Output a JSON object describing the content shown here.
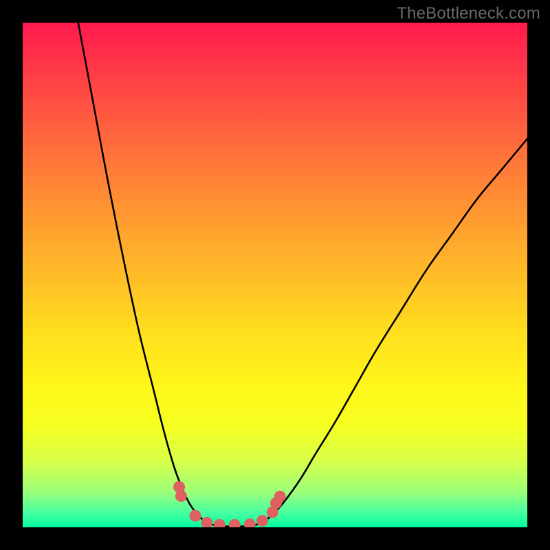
{
  "watermark": "TheBottleneck.com",
  "chart_data": {
    "type": "line",
    "title": "",
    "xlabel": "",
    "ylabel": "",
    "xlim": [
      0,
      100
    ],
    "ylim": [
      0,
      100
    ],
    "series": [
      {
        "name": "left-branch",
        "x": [
          11,
          14,
          17,
          20,
          23,
          26,
          28,
          30,
          31.5,
          33,
          34.5,
          36,
          38
        ],
        "y": [
          100,
          84,
          68,
          53,
          39,
          27,
          19,
          12,
          8,
          4.8,
          2.7,
          1.3,
          0.4
        ]
      },
      {
        "name": "valley-floor",
        "x": [
          38,
          40,
          42,
          44,
          46
        ],
        "y": [
          0.4,
          0.2,
          0.2,
          0.2,
          0.4
        ]
      },
      {
        "name": "right-branch",
        "x": [
          46,
          48,
          50,
          52,
          55,
          58,
          62,
          66,
          70,
          75,
          80,
          85,
          90,
          95,
          100
        ],
        "y": [
          0.4,
          1.3,
          3,
          5.3,
          9.5,
          14.5,
          21,
          28,
          35,
          43,
          51,
          58,
          65,
          71,
          77
        ]
      }
    ],
    "markers": {
      "color": "#de6060",
      "points": [
        {
          "x": 31,
          "y": 8.0
        },
        {
          "x": 31.4,
          "y": 6.2
        },
        {
          "x": 34.2,
          "y": 2.3
        },
        {
          "x": 36.5,
          "y": 0.9
        },
        {
          "x": 39,
          "y": 0.5
        },
        {
          "x": 42,
          "y": 0.5
        },
        {
          "x": 45,
          "y": 0.6
        },
        {
          "x": 47.5,
          "y": 1.3
        },
        {
          "x": 49.5,
          "y": 3.0
        },
        {
          "x": 50.2,
          "y": 4.8
        },
        {
          "x": 51,
          "y": 6.1
        }
      ]
    },
    "background_gradient": {
      "top": "#ff1a4e",
      "mid": "#ffe000",
      "bottom": "#00ff9d"
    }
  }
}
